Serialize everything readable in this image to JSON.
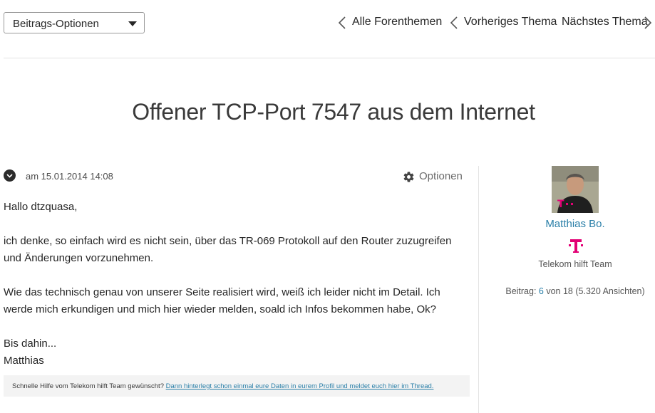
{
  "toolbar": {
    "options_dropdown": "Beitrags-Optionen",
    "all_topics": "Alle Forenthemen",
    "previous_topic": "Vorheriges Thema",
    "next_topic": "Nächstes Thema"
  },
  "thread": {
    "title": "Offener TCP-Port 7547 aus dem Internet"
  },
  "post": {
    "date": "am 15.01.2014 14:08",
    "options_label": "Optionen",
    "paragraphs": [
      "Hallo dtzquasa,",
      "ich denke, so einfach wird es nicht sein, über das TR-069 Protokoll auf den Router zuzugreifen und Änderungen vorzunehmen.",
      "Wie das technisch genau von unserer Seite realisiert wird, weiß ich leider nicht im Detail. Ich werde mich erkundigen und mich hier wieder melden, soald ich Infos bekommen habe, Ok?",
      "Bis dahin...",
      "Matthias"
    ],
    "hint_text": "Schnelle Hilfe vom Telekom hilft Team gewünscht? ",
    "hint_link": "Dann hinterlegt schon einmal eure Daten in eurem Profil und meldet euch hier im Thread."
  },
  "author": {
    "name": "Matthias Bo.",
    "role": "Telekom hilft Team",
    "stats_prefix": "Beitrag: ",
    "post_number": "6",
    "stats_suffix": " von 18 (5.320 Ansichten)"
  },
  "colors": {
    "brand_magenta": "#e20074",
    "link_blue": "#2a7fa8"
  }
}
